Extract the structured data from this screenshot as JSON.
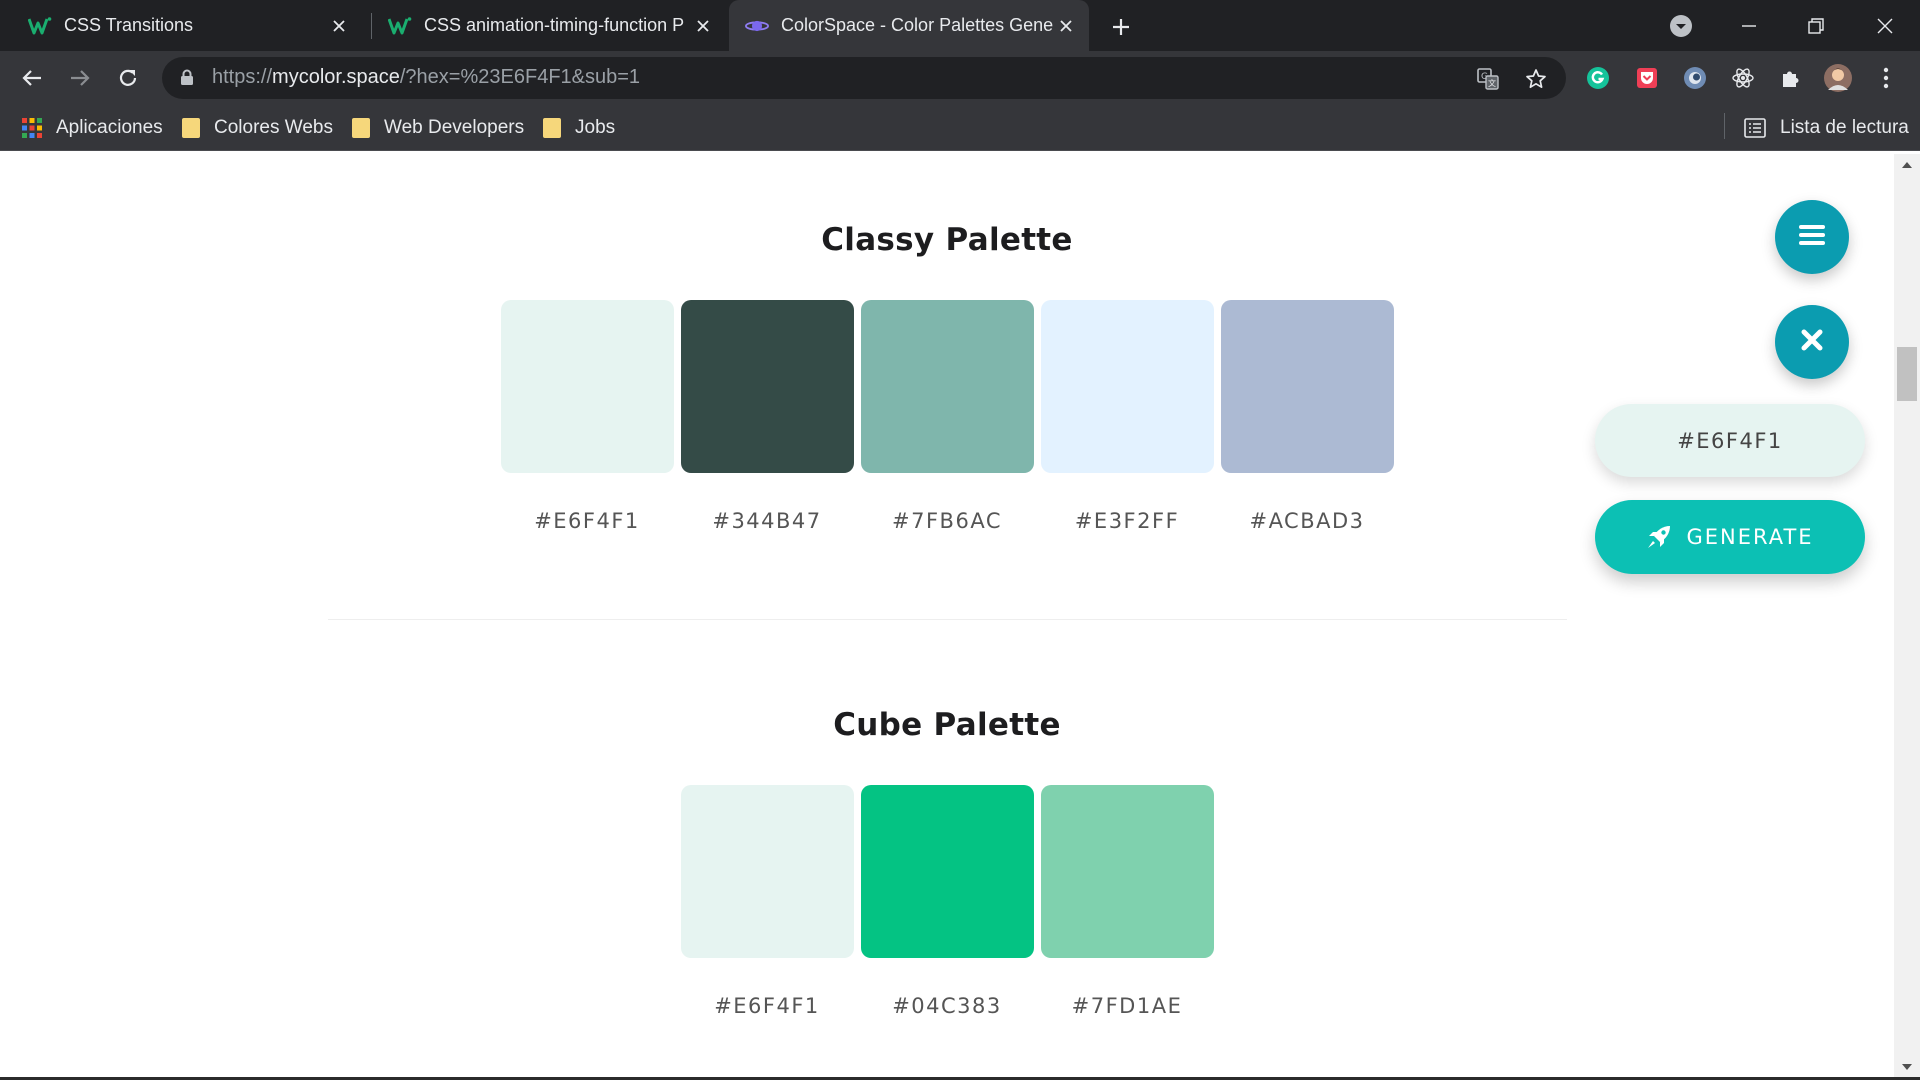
{
  "browser": {
    "tabs": [
      {
        "title": "CSS Transitions",
        "favicon": "w-logo-icon",
        "active": false
      },
      {
        "title": "CSS animation-timing-function P",
        "favicon": "w-logo-icon",
        "active": false
      },
      {
        "title": "ColorSpace - Color Palettes Gene",
        "favicon": "colorspace-planet-icon",
        "active": true
      }
    ],
    "url": {
      "scheme": "https://",
      "host": "mycolor.space",
      "path": "/?hex=%23E6F4F1&sub=1"
    },
    "bookmarks": [
      {
        "label": "Aplicaciones",
        "icon": "apps-grid-icon"
      },
      {
        "label": "Colores Webs",
        "icon": "folder-icon"
      },
      {
        "label": "Web Developers",
        "icon": "folder-icon"
      },
      {
        "label": "Jobs",
        "icon": "folder-icon"
      }
    ],
    "reading_list": "Lista de lectura",
    "colors": {
      "tabstrip": "#202124",
      "toolbar": "#35363a",
      "omnibox": "#202124",
      "folder": "#f6d77b"
    }
  },
  "page": {
    "palettes": [
      {
        "title": "Classy Palette",
        "colors": [
          {
            "hex": "#E6F4F1",
            "label": "#E6F4F1"
          },
          {
            "hex": "#344B47",
            "label": "#344B47"
          },
          {
            "hex": "#7FB6AC",
            "label": "#7FB6AC"
          },
          {
            "hex": "#E3F2FF",
            "label": "#E3F2FF"
          },
          {
            "hex": "#ACBAD3",
            "label": "#ACBAD3"
          }
        ]
      },
      {
        "title": "Cube Palette",
        "colors": [
          {
            "hex": "#E6F4F1",
            "label": "#E6F4F1"
          },
          {
            "hex": "#04C383",
            "label": "#04C383"
          },
          {
            "hex": "#7FD1AE",
            "label": "#7FD1AE"
          }
        ]
      }
    ],
    "widgets": {
      "menu_icon": "hamburger-menu-icon",
      "close_icon": "close-icon",
      "current_color": "#E6F4F1",
      "generate_label": "GENERATE",
      "generate_icon": "rocket-icon",
      "accent": "#0b9cb0",
      "generate_color": "#0cc0b4"
    }
  }
}
